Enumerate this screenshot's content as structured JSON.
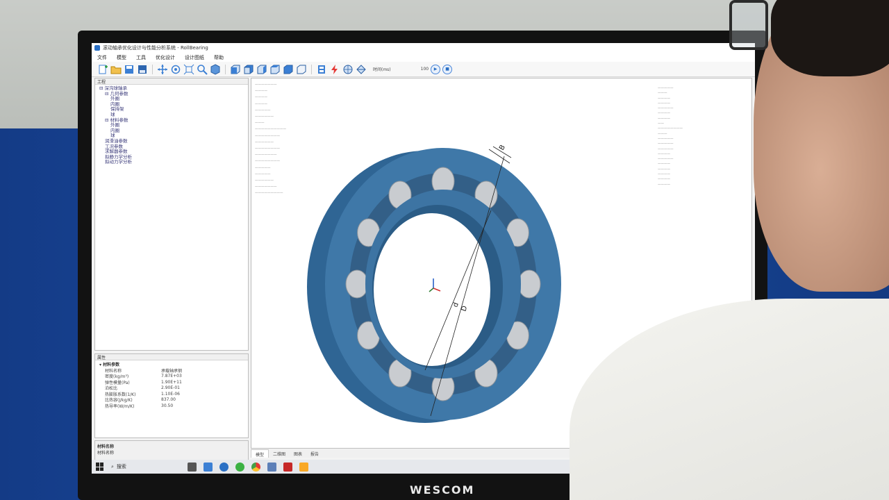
{
  "app": {
    "title": "滚动轴承优化设计与性能分析系统 - RollBearing"
  },
  "menu": [
    "文件",
    "模型",
    "工具",
    "优化设计",
    "设计图纸",
    "帮助"
  ],
  "toolbar": {
    "time_label": "时间(ms)",
    "time_value": "100",
    "icons": [
      "new-icon",
      "open-icon",
      "save-icon",
      "save-as-icon",
      "move-icon",
      "rotate-icon",
      "fit-icon",
      "zoom-icon",
      "cube-icon",
      "view-front-icon",
      "view-back-icon",
      "view-left-icon",
      "view-right-icon",
      "view-top-icon",
      "view-iso-icon",
      "export-icon",
      "lightning-icon",
      "mesh-icon",
      "render-icon"
    ]
  },
  "tree_panel": {
    "header": "工程",
    "items": [
      {
        "label": "⊟ 深沟球轴承",
        "level": 0
      },
      {
        "label": "⊟ 几何参数",
        "level": 1
      },
      {
        "label": "外圈",
        "level": 2
      },
      {
        "label": "内圈",
        "level": 2
      },
      {
        "label": "保持架",
        "level": 2
      },
      {
        "label": "球",
        "level": 2
      },
      {
        "label": "⊟ 材料参数",
        "level": 1
      },
      {
        "label": "外圈",
        "level": 2
      },
      {
        "label": "内圈",
        "level": 2
      },
      {
        "label": "球",
        "level": 2
      },
      {
        "label": "润滑油参数",
        "level": 1
      },
      {
        "label": "工况参数",
        "level": 1
      },
      {
        "label": "求解器参数",
        "level": 1
      },
      {
        "label": "拟静力学分析",
        "level": 1
      },
      {
        "label": "拟动力学分析",
        "level": 1
      }
    ]
  },
  "properties": {
    "header": "属性",
    "group": "材料参数",
    "rows": [
      {
        "key": "材料名称",
        "value": "承载轴承钢"
      },
      {
        "key": "密度(kg/m³)",
        "value": "7.87E+03"
      },
      {
        "key": "弹性模量(Pa)",
        "value": "1.90E+11"
      },
      {
        "key": "泊松比",
        "value": "2.90E-01"
      },
      {
        "key": "热膨胀系数(1/K)",
        "value": "1.10E-06"
      },
      {
        "key": "比热容(J/kg/K)",
        "value": "837.00"
      },
      {
        "key": "热导率(W/m/K)",
        "value": "30.50"
      }
    ]
  },
  "description": {
    "title": "材料名称",
    "text": "材料名称"
  },
  "viewport": {
    "dimension_labels": [
      "B",
      "d",
      "D"
    ]
  },
  "tabs": [
    "模型",
    "二维图",
    "图表",
    "报告"
  ],
  "taskbar": {
    "search_label": "搜索"
  },
  "colors": {
    "bearing": "#3f78a8",
    "bearing_dark": "#2b5c86",
    "ball": "#c9ccd0",
    "accent": "#2a6fc4"
  },
  "brand": "WESCOM"
}
